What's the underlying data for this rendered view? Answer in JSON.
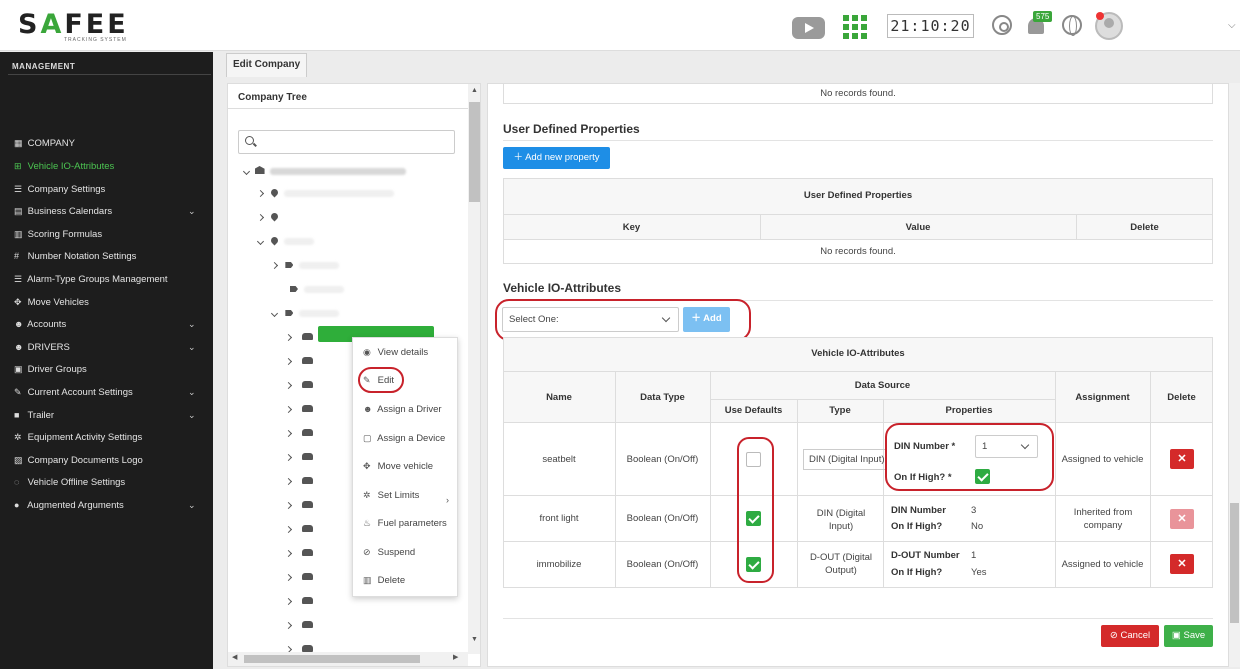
{
  "header": {
    "logo_text_pre": "S",
    "logo_text_mid": "A",
    "logo_text_post": "FEE",
    "logo_sub": "TRACKING SYSTEM",
    "clock": "21:10:20",
    "notification_count": "575"
  },
  "sidebar": {
    "title": "MANAGEMENT",
    "items": [
      {
        "label": "COMPANY",
        "icon": "building-icon",
        "active": false
      },
      {
        "label": "Vehicle IO-Attributes",
        "icon": "grid-icon",
        "active": true
      },
      {
        "label": "Company Settings",
        "icon": "list-icon",
        "active": false
      },
      {
        "label": "Business Calendars",
        "icon": "calendar-icon",
        "active": false,
        "expandable": true
      },
      {
        "label": "Scoring Formulas",
        "icon": "calculator-icon",
        "active": false
      },
      {
        "label": "Number Notation Settings",
        "icon": "hash-icon",
        "active": false
      },
      {
        "label": "Alarm-Type Groups Management",
        "icon": "list-icon",
        "active": false
      },
      {
        "label": "Move Vehicles",
        "icon": "move-icon",
        "active": false
      },
      {
        "label": "Accounts",
        "icon": "users-icon",
        "active": false,
        "expandable": true
      },
      {
        "label": "DRIVERS",
        "icon": "users-icon",
        "active": false,
        "expandable": true
      },
      {
        "label": "Driver Groups",
        "icon": "id-card-icon",
        "active": false
      },
      {
        "label": "Current Account Settings",
        "icon": "wrench-icon",
        "active": false,
        "expandable": true
      },
      {
        "label": "Trailer",
        "icon": "trailer-icon",
        "active": false,
        "expandable": true
      },
      {
        "label": "Equipment Activity Settings",
        "icon": "gears-icon",
        "active": false
      },
      {
        "label": "Company Documents Logo",
        "icon": "image-icon",
        "active": false
      },
      {
        "label": "Vehicle Offline Settings",
        "icon": "eye-slash-icon",
        "active": false
      },
      {
        "label": "Augmented Arguments",
        "icon": "circle-icon",
        "active": false,
        "expandable": true
      }
    ]
  },
  "tab": {
    "label": "Edit Company"
  },
  "company_tree": {
    "title": "Company Tree",
    "search_placeholder": ""
  },
  "context_menu": {
    "items": [
      {
        "label": "View details",
        "icon": "eye-icon"
      },
      {
        "label": "Edit",
        "icon": "pencil-icon"
      },
      {
        "label": "Assign a Driver",
        "icon": "user-icon"
      },
      {
        "label": "Assign a Device",
        "icon": "device-icon"
      },
      {
        "label": "Move vehicle",
        "icon": "move-icon"
      },
      {
        "label": "Set Limits",
        "icon": "gear-icon"
      },
      {
        "label": "Fuel parameters",
        "icon": "fuel-icon"
      },
      {
        "label": "Suspend",
        "icon": "ban-icon"
      },
      {
        "label": "Delete",
        "icon": "trash-icon"
      }
    ]
  },
  "top_table": {
    "empty_text": "No records found."
  },
  "user_defined": {
    "title": "User Defined Properties",
    "add_button": "Add new property",
    "table_title": "User Defined Properties",
    "columns": [
      "Key",
      "Value",
      "Delete"
    ],
    "empty_text": "No records found."
  },
  "io_attributes": {
    "title": "Vehicle IO-Attributes",
    "select_placeholder": "Select One:",
    "add_button": "Add",
    "table_title": "Vehicle IO-Attributes",
    "columns": {
      "name": "Name",
      "data_type": "Data Type",
      "data_source": "Data Source",
      "use_defaults": "Use Defaults",
      "type": "Type",
      "properties": "Properties",
      "assignment": "Assignment",
      "delete": "Delete"
    },
    "rows": [
      {
        "name": "seatbelt",
        "data_type": "Boolean (On/Off)",
        "use_defaults": false,
        "type": "DIN (Digital Input)",
        "prop1_label": "DIN Number",
        "prop1_value": "1",
        "prop2_label": "On If High?",
        "prop2_value": "",
        "assignment": "Assigned to vehicle"
      },
      {
        "name": "front light",
        "data_type": "Boolean (On/Off)",
        "use_defaults": true,
        "type": "DIN (Digital Input)",
        "prop1_label": "DIN Number",
        "prop1_value": "3",
        "prop2_label": "On If High?",
        "prop2_value": "No",
        "assignment": "Inherited from company"
      },
      {
        "name": "immobilize",
        "data_type": "Boolean (On/Off)",
        "use_defaults": true,
        "type": "D-OUT (Digital Output)",
        "prop1_label": "D-OUT Number",
        "prop1_value": "1",
        "prop2_label": "On If High?",
        "prop2_value": "Yes",
        "assignment": "Assigned to vehicle"
      }
    ],
    "required_mark": "*"
  },
  "footer": {
    "cancel": "Cancel",
    "save": "Save"
  },
  "colors": {
    "accent_green": "#3aa63a",
    "primary_blue": "#1e8ee6",
    "danger_red": "#d42a2a",
    "annotation_red": "#c8222b"
  }
}
